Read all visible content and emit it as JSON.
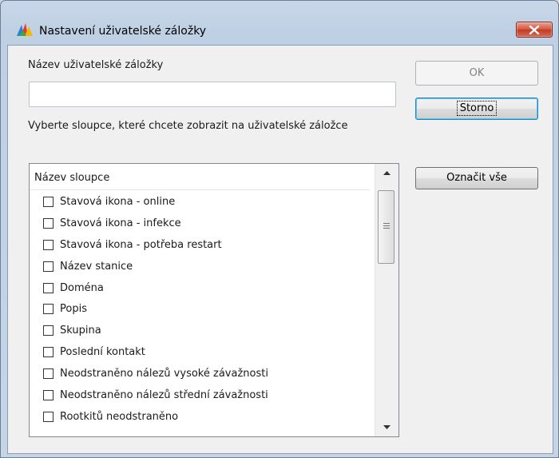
{
  "window": {
    "title": "Nastavení uživatelské záložky"
  },
  "form": {
    "name_label": "Název uživatelské záložky",
    "name_value": "",
    "instruction": "Vyberte sloupce, které chcete zobrazit na uživatelské záložce"
  },
  "buttons": {
    "ok": "OK",
    "cancel": "Storno",
    "select_all": "Označit vše"
  },
  "list": {
    "header": "Název sloupce",
    "items": [
      {
        "label": "Stavová ikona - online",
        "checked": false
      },
      {
        "label": "Stavová ikona - infekce",
        "checked": false
      },
      {
        "label": "Stavová ikona - potřeba restart",
        "checked": false
      },
      {
        "label": "Název stanice",
        "checked": false
      },
      {
        "label": "Doména",
        "checked": false
      },
      {
        "label": "Popis",
        "checked": false
      },
      {
        "label": "Skupina",
        "checked": false
      },
      {
        "label": "Poslední kontakt",
        "checked": false
      },
      {
        "label": "Neodstraněno nálezů vysoké závažnosti",
        "checked": false
      },
      {
        "label": "Neodstraněno nálezů střední závažnosti",
        "checked": false
      },
      {
        "label": "Rootkitů neodstraněno",
        "checked": false
      }
    ]
  },
  "colors": {
    "close_button": "#d4533d",
    "title_bar": "#c9d7e8"
  }
}
